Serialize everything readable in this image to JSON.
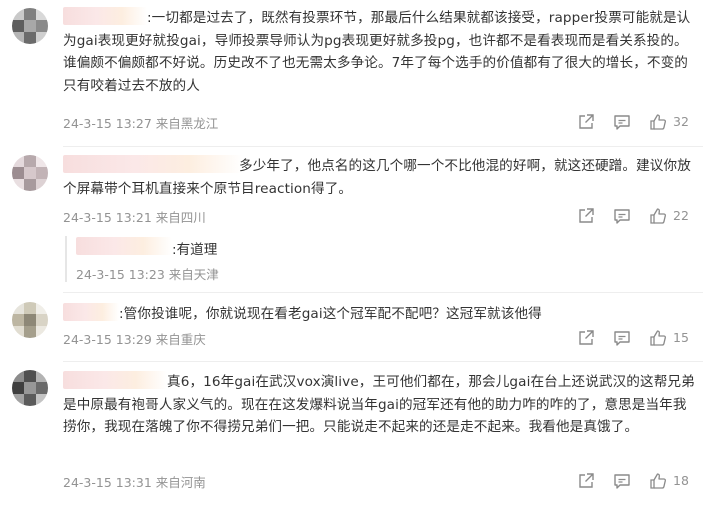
{
  "comments": [
    {
      "text": ":一切都是过去了，既然有投票环节，那最后什么结果就都该接受，rapper投票可能就是认为gai表现更好就投gai，导师投票导师认为pg表现更好就多投pg，也许都不是看表现而是看关系投的。谁偏颇不偏颇都不好说。历史改不了也无需太多争论。7年了每个选手的价值都有了很大的增长，不变的只有咬着过去不放的人",
      "date": "24-3-15 13:27",
      "location": "来自黑龙江",
      "likes": "32"
    },
    {
      "text": "多少年了，他点名的这几个哪一个不比他混的好啊，就这还硬蹭。建议你放个屏幕带个耳机直接来个原节目reaction得了。",
      "date": "24-3-15 13:21",
      "location": "来自四川",
      "likes": "22",
      "reply": {
        "text": ":有道理",
        "date": "24-3-15 13:23",
        "location": "来自天津"
      }
    },
    {
      "text": ":管你投谁呢，你就说现在看老gai这个冠军配不配吧？这冠军就该他得",
      "date": "24-3-15 13:29",
      "location": "来自重庆",
      "likes": "15"
    },
    {
      "text": "真6，16年gai在武汉vox演live，王可他们都在，那会儿gai在台上还说武汉的这帮兄弟是中原最有袍哥人家义气的。现在在这发爆料说当年gai的冠军还有他的助力咋的咋的了，意思是当年我捞你，我现在落魄了你不得捞兄弟们一把。只能说走不起来的还是走不起来。我看他是真饿了。",
      "date": "24-3-15 13:31",
      "location": "来自河南",
      "likes": "18"
    }
  ],
  "icons": {
    "share": "share-icon",
    "comment": "comment-icon",
    "like": "thumbs-up-icon"
  }
}
